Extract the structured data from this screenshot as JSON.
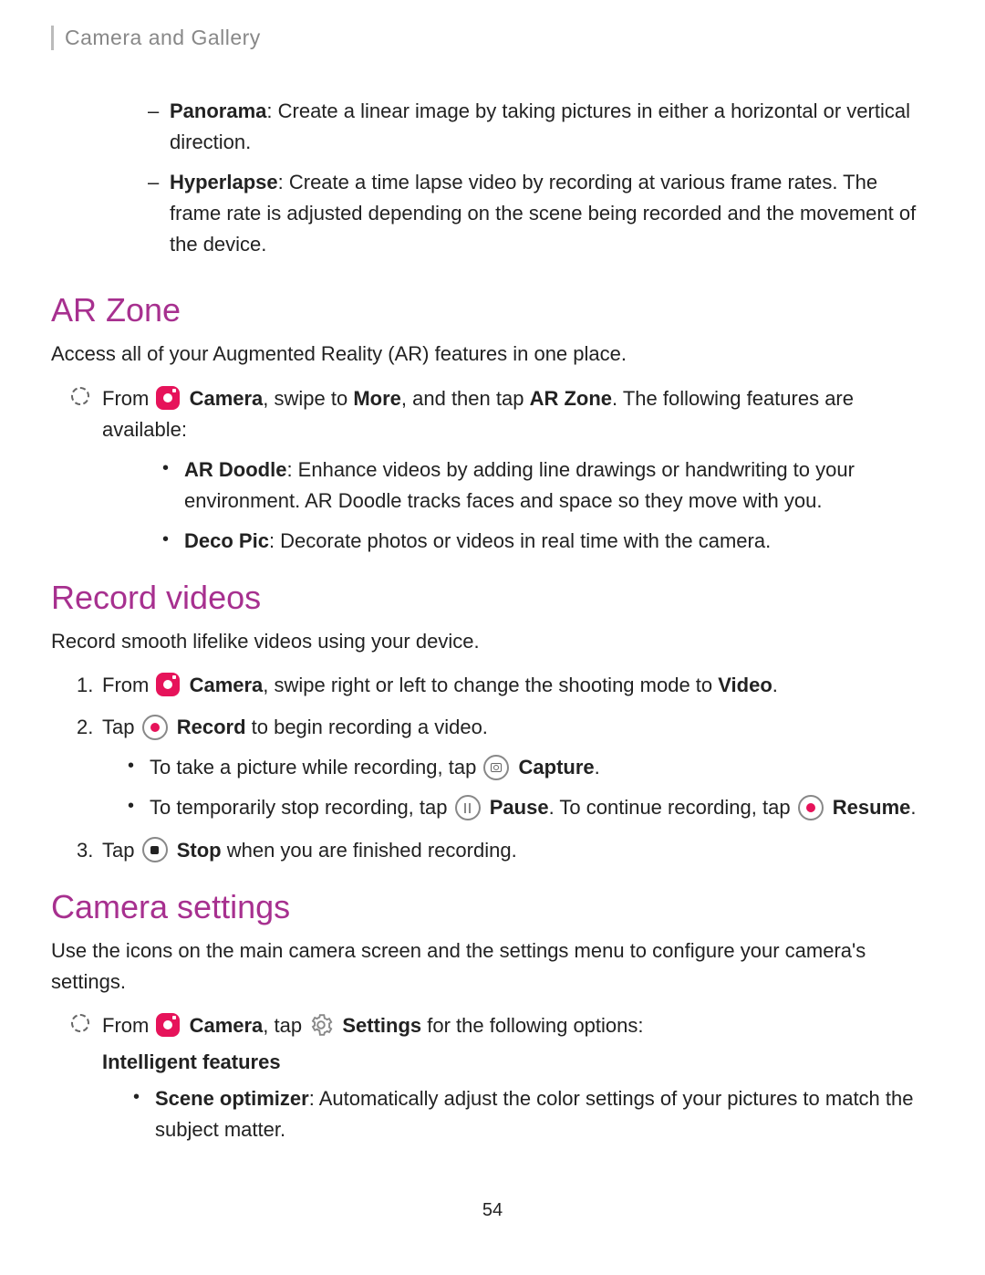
{
  "header": {
    "title": "Camera and Gallery"
  },
  "dash": {
    "panorama_bold": "Panorama",
    "panorama_rest": ": Create a linear image by taking pictures in either a horizontal or vertical direction.",
    "hyperlapse_bold": "Hyperlapse",
    "hyperlapse_rest": ": Create a time lapse video by recording at various frame rates. The frame rate is adjusted depending on the scene being recorded and the movement of the device."
  },
  "arzone": {
    "title": "AR Zone",
    "intro": "Access all of your Augmented Reality (AR) features in one place.",
    "from_prefix": "From ",
    "camera_label": "Camera",
    "swipe_text": ", swipe to ",
    "more_bold": "More",
    "tap_text": ", and then tap ",
    "arzone_bold": "AR Zone",
    "tail": ". The following features are available:",
    "ardoodle_bold": "AR Doodle",
    "ardoodle_rest": ": Enhance videos by adding line drawings or handwriting to your environment. AR Doodle tracks faces and space so they move with you.",
    "decopic_bold": "Deco Pic",
    "decopic_rest": ": Decorate photos or videos in real time with the camera."
  },
  "record": {
    "title": "Record videos",
    "intro": "Record smooth lifelike videos using your device.",
    "n1_prefix": "From ",
    "n1_camera": "Camera",
    "n1_mid": ", swipe right or left to change the shooting mode to ",
    "n1_video": "Video",
    "n1_end": ".",
    "n2_tap": "Tap ",
    "n2_record": "Record",
    "n2_rest": " to begin recording a video.",
    "sub1_prefix": "To take a picture while recording, tap ",
    "sub1_capture": "Capture",
    "sub1_end": ".",
    "sub2_prefix": "To temporarily stop recording, tap ",
    "sub2_pause": "Pause",
    "sub2_mid": ". To continue recording, tap ",
    "sub2_resume": "Resume",
    "sub2_end": ".",
    "n3_tap": "Tap ",
    "n3_stop": "Stop",
    "n3_rest": " when you are finished recording.",
    "num1": "1.",
    "num2": "2.",
    "num3": "3."
  },
  "settings": {
    "title": "Camera settings",
    "intro": "Use the icons on the main camera screen and the settings menu to configure your camera's settings.",
    "from_prefix": "From ",
    "camera": "Camera",
    "tap": ", tap ",
    "settings_label": "Settings",
    "rest": " for the following options:",
    "subhead": "Intelligent features",
    "scene_bold": "Scene optimizer",
    "scene_rest": ": Automatically adjust the color settings of your pictures to match the subject matter."
  },
  "page_number": "54"
}
